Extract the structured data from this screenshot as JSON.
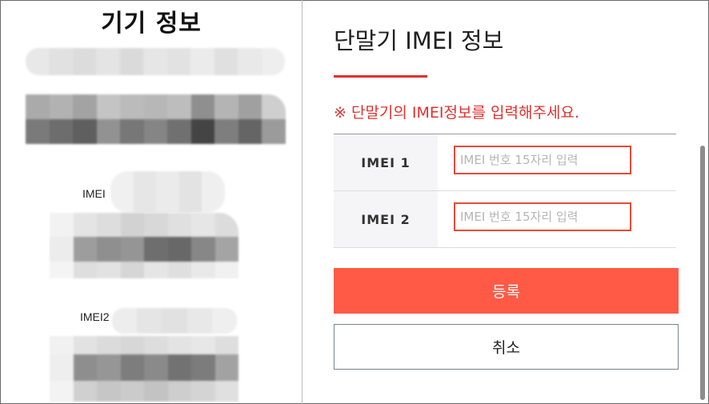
{
  "left_panel": {
    "title": "기기 정보",
    "imei1_label": "IMEI",
    "imei2_label": "IMEI2"
  },
  "right_panel": {
    "title": "단말기 IMEI 정보",
    "notice": "※ 단말기의 IMEI정보를 입력해주세요.",
    "fields": [
      {
        "label": "IMEI 1",
        "placeholder": "IMEI 번호 15자리 입력",
        "value": ""
      },
      {
        "label": "IMEI 2",
        "placeholder": "IMEI 번호 15자리 입력",
        "value": ""
      }
    ],
    "register_label": "등록",
    "cancel_label": "취소"
  },
  "colors": {
    "accent": "#e0312e",
    "register_bg": "#ff5a45",
    "input_border": "#e64b3a"
  }
}
